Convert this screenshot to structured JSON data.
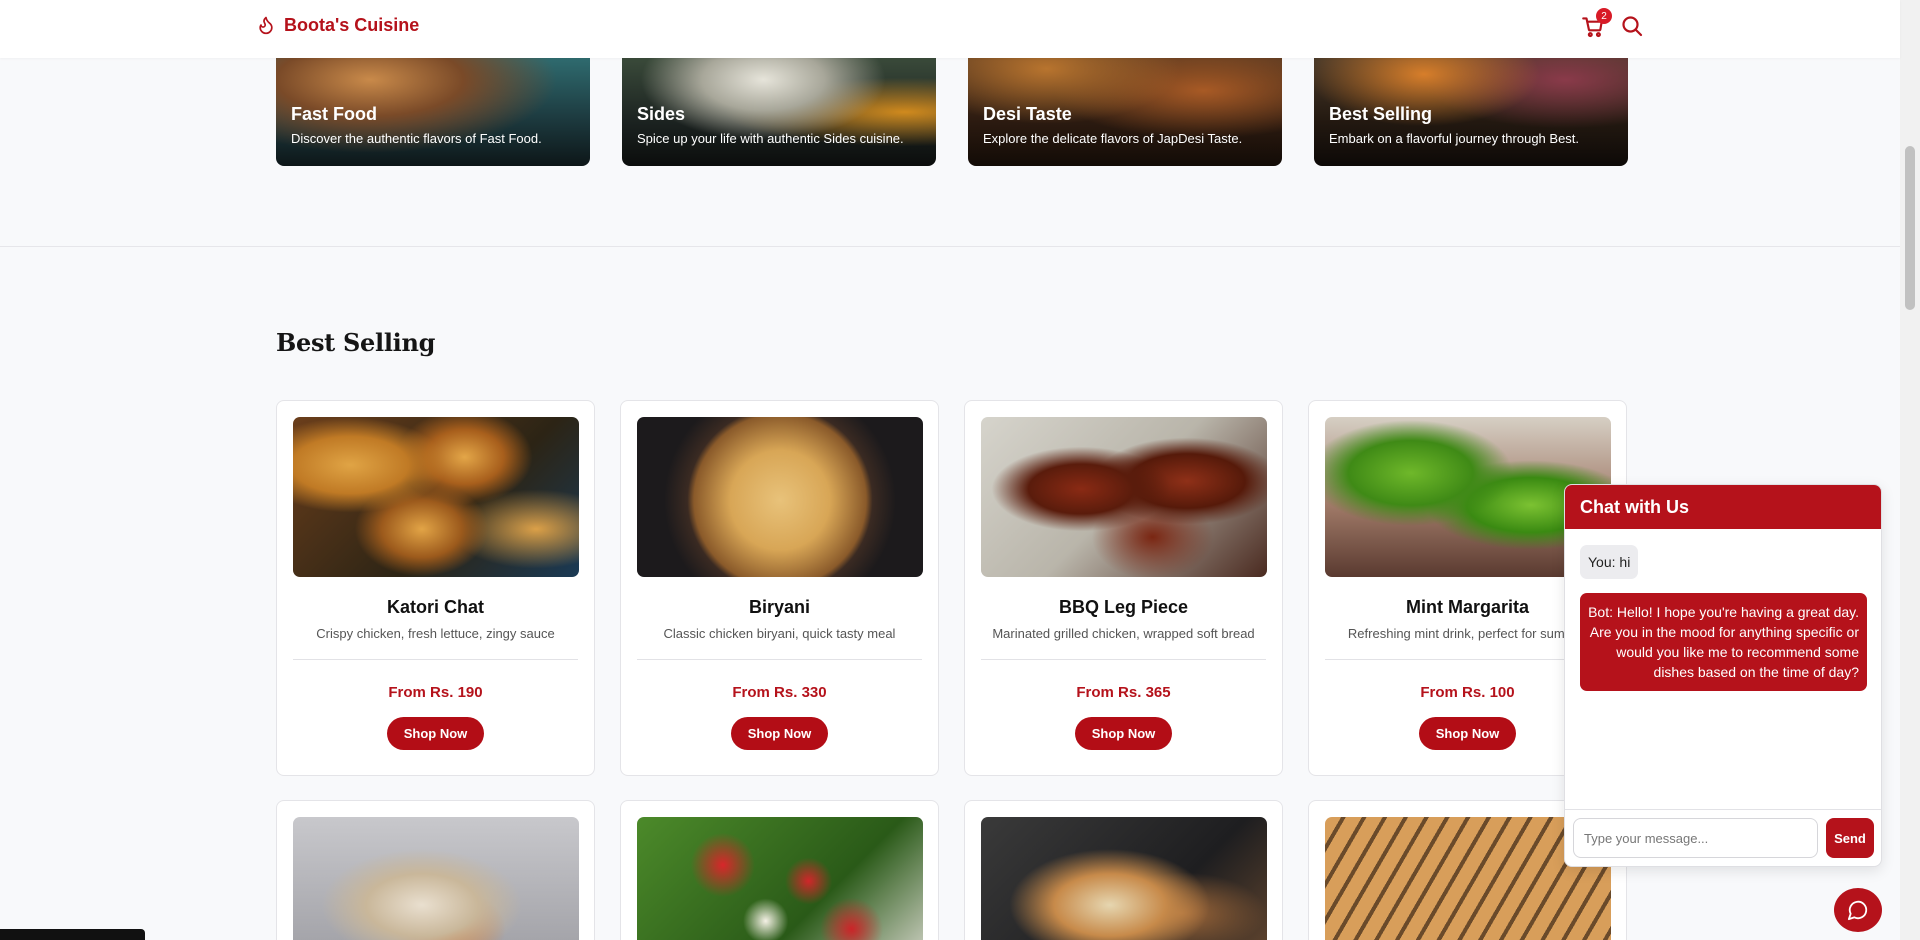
{
  "header": {
    "brand": "Boota's Cuisine",
    "cart_count": "2",
    "icons": [
      "flame-icon",
      "cart-icon",
      "search-icon"
    ]
  },
  "categories": [
    {
      "title": "Fast Food",
      "desc": "Discover the authentic flavors of Fast Food."
    },
    {
      "title": "Sides",
      "desc": "Spice up your life with authentic Sides cuisine."
    },
    {
      "title": "Desi Taste",
      "desc": "Explore the delicate flavors of JapDesi Taste."
    },
    {
      "title": "Best Selling",
      "desc": "Embark on a flavorful journey through Best."
    }
  ],
  "section": {
    "title": "Best Selling"
  },
  "products": [
    {
      "name": "Katori Chat",
      "desc": "Crispy chicken, fresh lettuce, zingy sauce",
      "price": "From Rs. 190",
      "button": "Shop Now"
    },
    {
      "name": "Biryani",
      "desc": "Classic chicken biryani, quick tasty meal",
      "price": "From Rs. 330",
      "button": "Shop Now"
    },
    {
      "name": "BBQ Leg Piece",
      "desc": "Marinated grilled chicken, wrapped soft bread",
      "price": "From Rs. 365",
      "button": "Shop Now"
    },
    {
      "name": "Mint Margarita",
      "desc": "Refreshing mint drink, perfect for summer",
      "price": "From Rs. 100",
      "button": "Shop Now"
    }
  ],
  "chat": {
    "title": "Chat with Us",
    "user_msg": "You: hi",
    "bot_msg": "Bot: Hello! I hope you're having a great day. Are you in the mood for anything specific or would you like me to recommend some dishes based on the time of day?",
    "input_placeholder": "Type your message...",
    "send_label": "Send"
  },
  "colors": {
    "brand": "#b5121b",
    "background": "#f8f9fb"
  }
}
